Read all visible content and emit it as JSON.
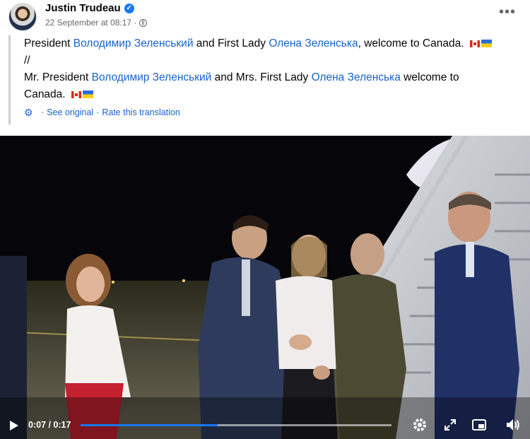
{
  "post": {
    "author": "Justin Trudeau",
    "verified_icon": "verified-badge-icon",
    "timestamp": "22 September at 08:17 ·",
    "privacy_icon": "globe-icon",
    "more_label": "•••"
  },
  "translation": {
    "line1": {
      "prefix": "President ",
      "name1": "Володимир Зеленський",
      "middle": " and First Lady ",
      "name2": "Олена Зеленська",
      "suffix": ", welcome to Canada."
    },
    "line2": "//",
    "line3": {
      "prefix": "Mr. President ",
      "name1": "Володимир Зеленський",
      "middle": " and Mrs. First Lady ",
      "name2": "Олена Зеленська",
      "suffix": " welcome to"
    },
    "line4": "Canada.",
    "see_original": "See original",
    "separator": "·",
    "rate_translation": "Rate this translation"
  },
  "video": {
    "time": "0:07 / 0:17",
    "progress_fraction": 0.44,
    "colors": {
      "progress": "#1877f2",
      "link": "#1763cf"
    }
  }
}
